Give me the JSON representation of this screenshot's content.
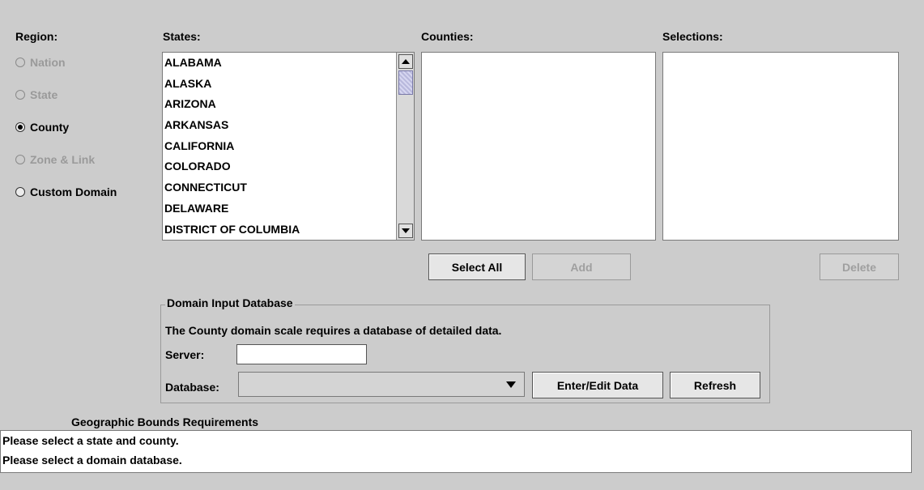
{
  "region": {
    "label": "Region:",
    "options": [
      {
        "label": "Nation",
        "state": "disabled",
        "checked": false
      },
      {
        "label": "State",
        "state": "disabled",
        "checked": false
      },
      {
        "label": "County",
        "state": "enabled",
        "checked": true
      },
      {
        "label": "Zone & Link",
        "state": "disabled",
        "checked": false
      },
      {
        "label": "Custom Domain",
        "state": "enabled",
        "checked": false
      }
    ]
  },
  "states": {
    "label": "States:",
    "items": [
      "ALABAMA",
      "ALASKA",
      "ARIZONA",
      "ARKANSAS",
      "CALIFORNIA",
      "COLORADO",
      "CONNECTICUT",
      "DELAWARE",
      "DISTRICT OF COLUMBIA"
    ]
  },
  "counties": {
    "label": "Counties:",
    "items": []
  },
  "selections": {
    "label": "Selections:",
    "items": []
  },
  "buttons": {
    "select_all": "Select All",
    "add": "Add",
    "delete": "Delete",
    "enter_edit": "Enter/Edit Data",
    "refresh": "Refresh"
  },
  "domain_db": {
    "title": "Domain Input Database",
    "description": "The County domain scale requires a database of detailed data.",
    "server_label": "Server:",
    "server_value": "",
    "database_label": "Database:",
    "database_value": ""
  },
  "bounds": {
    "title": "Geographic Bounds Requirements",
    "messages": [
      "Please select a state and county.",
      "Please select a domain database."
    ]
  }
}
